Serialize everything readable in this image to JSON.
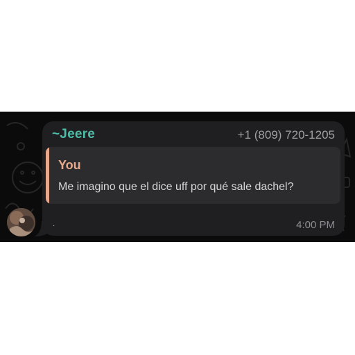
{
  "message": {
    "sender_prefix": "~",
    "sender_name": "Jeere",
    "sender_phone": "+1 (809) 720-1205",
    "quoted": {
      "author": "You",
      "text": "Me imagino que el dice uff por qué sale dachel?"
    },
    "body": "·",
    "time": "4:00 PM"
  },
  "colors": {
    "chat_background": "#0b0b0b",
    "bubble": "#1f1f21",
    "sender_name": "#4fbca7",
    "quote_accent": "#e9a88b",
    "quote_background": "#2c2c2e"
  }
}
